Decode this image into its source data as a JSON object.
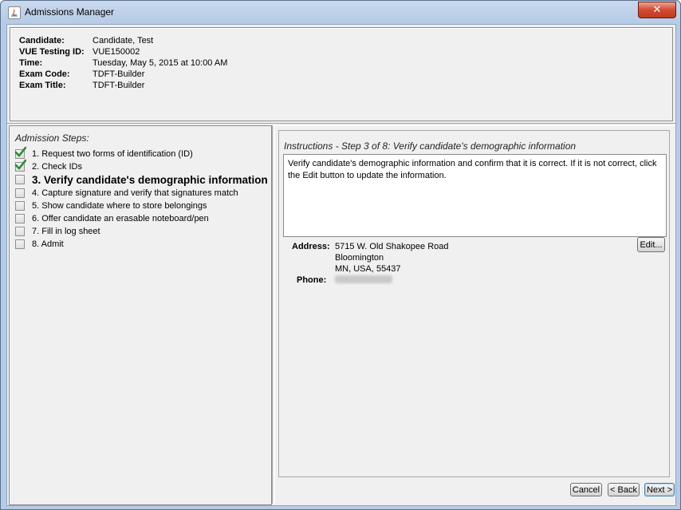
{
  "window": {
    "title": "Admissions Manager",
    "close_glyph": "✕"
  },
  "candidate_info": [
    {
      "label": "Candidate:",
      "value": "Candidate, Test"
    },
    {
      "label": "VUE Testing ID:",
      "value": "VUE150002"
    },
    {
      "label": "Time:",
      "value": "Tuesday, May 5, 2015 at 10:00 AM"
    },
    {
      "label": "Exam Code:",
      "value": "TDFT-Builder"
    },
    {
      "label": "Exam Title:",
      "value": "TDFT-Builder"
    }
  ],
  "steps_panel": {
    "title": "Admission Steps:",
    "steps": [
      {
        "label": "1. Request two forms of identification (ID)",
        "checked": true,
        "current": false
      },
      {
        "label": "2. Check IDs",
        "checked": true,
        "current": false
      },
      {
        "label": "3. Verify candidate's demographic information",
        "checked": false,
        "current": true
      },
      {
        "label": "4. Capture signature and verify that signatures match",
        "checked": false,
        "current": false
      },
      {
        "label": "5. Show candidate where to store belongings",
        "checked": false,
        "current": false
      },
      {
        "label": "6. Offer candidate an erasable noteboard/pen",
        "checked": false,
        "current": false
      },
      {
        "label": "7. Fill in log sheet",
        "checked": false,
        "current": false
      },
      {
        "label": "8. Admit",
        "checked": false,
        "current": false
      }
    ]
  },
  "instructions": {
    "title": "Instructions - Step 3 of 8: Verify candidate's demographic information",
    "text": "Verify candidate's demographic information and confirm that it is correct. If it is not correct, click the Edit button to update the information."
  },
  "demographics": {
    "address_label": "Address:",
    "address_lines": [
      "5715 W. Old Shakopee Road",
      "Bloomington",
      "MN, USA, 55437"
    ],
    "phone_label": "Phone:"
  },
  "buttons": {
    "edit": "Edit...",
    "cancel": "Cancel",
    "back": "< Back",
    "next": "Next >"
  },
  "colors": {
    "titlebar": "#b6cbe6",
    "close_button": "#d24a32",
    "checkmark": "#2e8b2e",
    "panel_bg": "#f0f0f0"
  }
}
